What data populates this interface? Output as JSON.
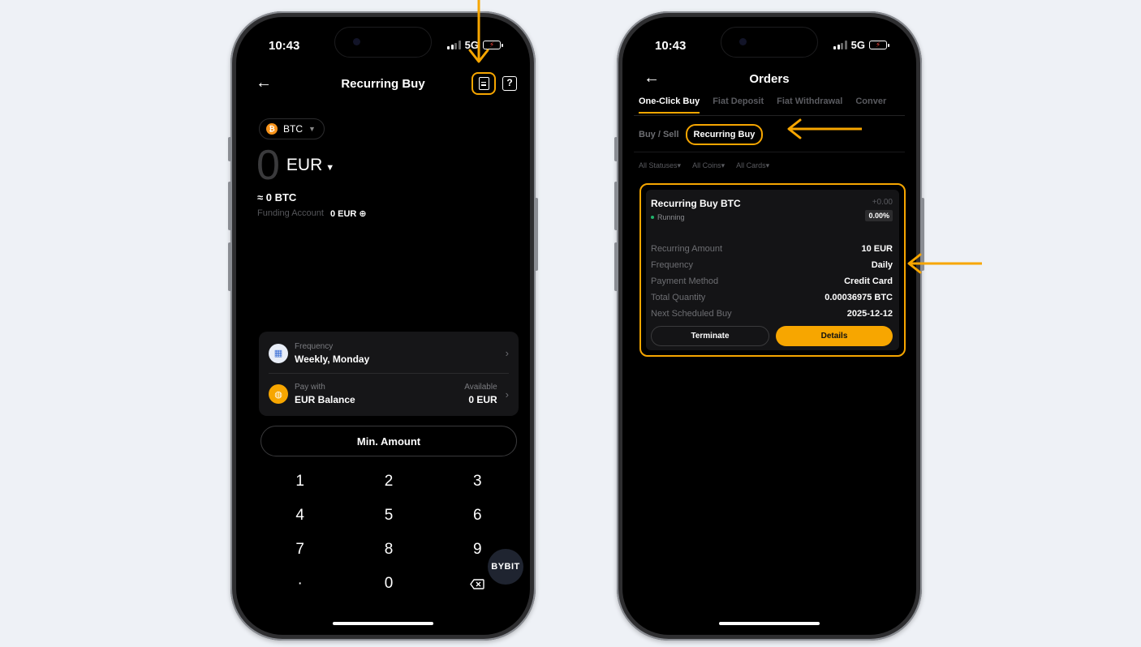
{
  "left_phone": {
    "status": {
      "time": "10:43",
      "network": "5G"
    },
    "nav": {
      "back_icon": "arrow-left-icon",
      "title": "Recurring Buy"
    },
    "coin_selector": {
      "coin": "BTC"
    },
    "amount": {
      "value": "0",
      "currency": "EUR"
    },
    "approx": "≈ 0 BTC",
    "funding": {
      "label": "Funding Account",
      "value": "0 EUR"
    },
    "frequency": {
      "label": "Frequency",
      "value": "Weekly, Monday"
    },
    "pay_with": {
      "label": "Pay with",
      "value": "EUR Balance",
      "available_label": "Available",
      "available_value": "0 EUR"
    },
    "min_amount_label": "Min. Amount",
    "keypad": [
      "1",
      "2",
      "3",
      "4",
      "5",
      "6",
      "7",
      "8",
      "9",
      "·",
      "0"
    ],
    "badge": "BYBIT"
  },
  "right_phone": {
    "status": {
      "time": "10:43",
      "network": "5G"
    },
    "nav": {
      "title": "Orders"
    },
    "tabs": [
      "One-Click Buy",
      "Fiat Deposit",
      "Fiat Withdrawal",
      "Conver"
    ],
    "subtabs": [
      "Buy / Sell",
      "Recurring Buy"
    ],
    "filters": [
      "All Statuses",
      "All Coins",
      "All Cards"
    ],
    "order": {
      "title": "Recurring Buy BTC",
      "status": "Running",
      "pnl": "+0.00",
      "pnl_pct": "0.00%",
      "rows": [
        {
          "k": "Recurring Amount",
          "v": "10 EUR"
        },
        {
          "k": "Frequency",
          "v": "Daily"
        },
        {
          "k": "Payment Method",
          "v": "Credit Card"
        },
        {
          "k": "Total Quantity",
          "v": "0.00036975 BTC"
        },
        {
          "k": "Next Scheduled Buy",
          "v": "2025-12-12"
        }
      ],
      "terminate_label": "Terminate",
      "details_label": "Details"
    }
  },
  "colors": {
    "accent": "#f7a600",
    "running": "#20b26c",
    "background": "#eef1f6"
  }
}
